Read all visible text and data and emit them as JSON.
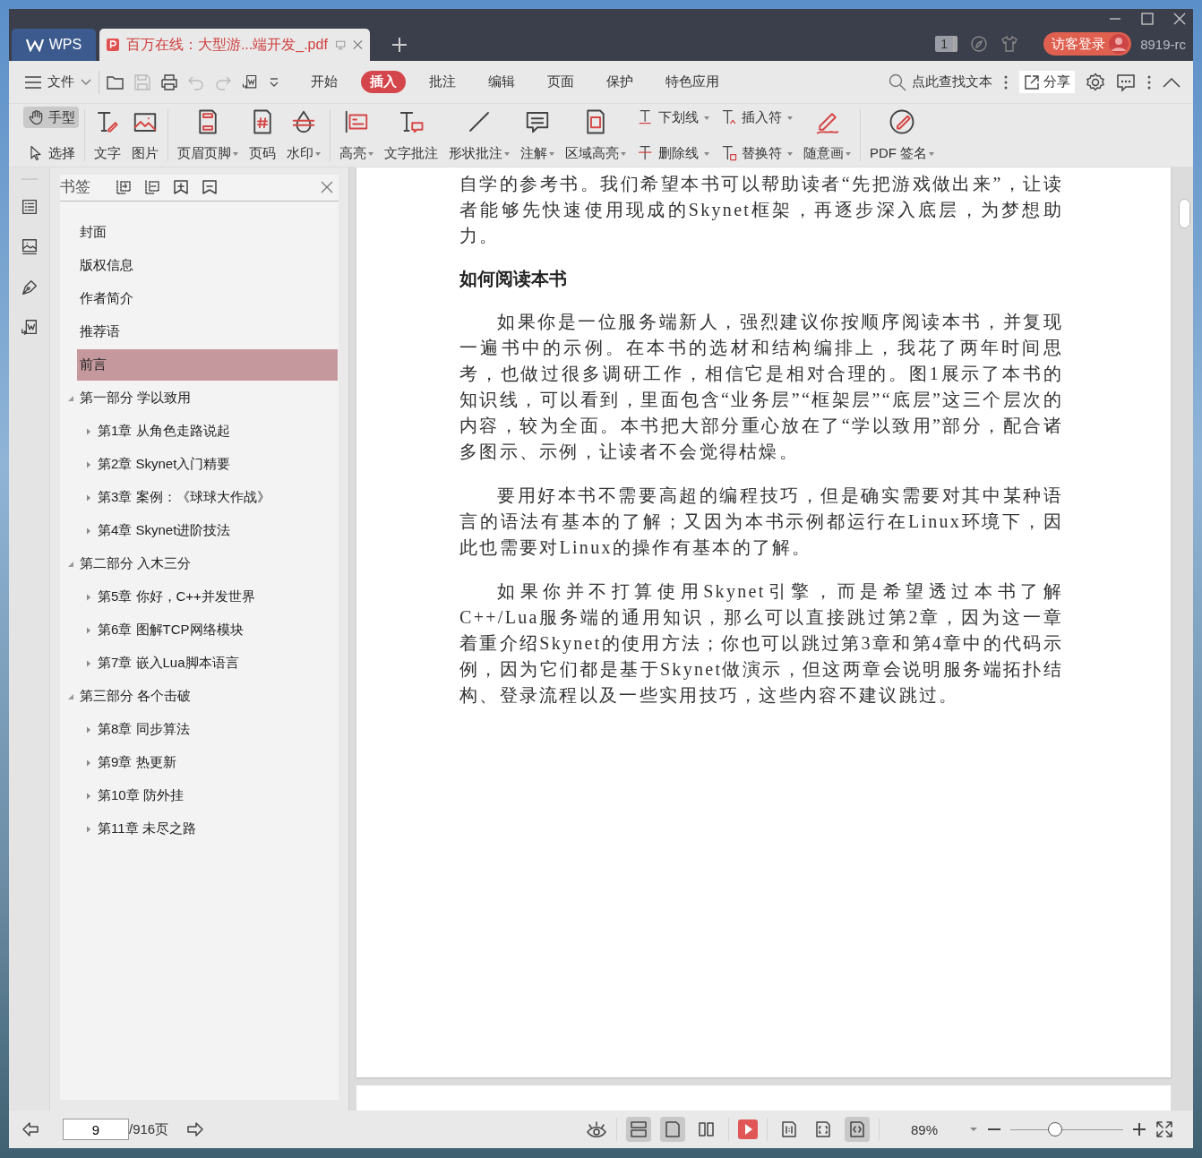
{
  "title_bar": {
    "app_tab": "WPS",
    "doc_tab": {
      "title": "百万在线：大型游...端开发_.pdf",
      "selected": true
    },
    "page_badge": "1",
    "login": "访客登录",
    "user": "8919-rc"
  },
  "menu_bar": {
    "file": "文件",
    "tabs": [
      {
        "label": "开始",
        "selected": false
      },
      {
        "label": "插入",
        "selected": true
      },
      {
        "label": "批注",
        "selected": false
      },
      {
        "label": "编辑",
        "selected": false
      },
      {
        "label": "页面",
        "selected": false
      },
      {
        "label": "保护",
        "selected": false
      },
      {
        "label": "特色应用",
        "selected": false
      }
    ],
    "search": "点此查找文本",
    "share": "分享"
  },
  "toolbar": {
    "groups": [
      {
        "columns": [
          {
            "items": [
              {
                "label": "手型",
                "kind": "small",
                "dropdown": false,
                "selected": true
              },
              {
                "label": "选择",
                "kind": "small",
                "dropdown": false,
                "selected": false
              }
            ]
          }
        ]
      },
      {
        "columns": [
          {
            "items": [
              {
                "label": "文字",
                "kind": "large",
                "dropdown": false
              }
            ]
          },
          {
            "items": [
              {
                "label": "图片",
                "kind": "large",
                "dropdown": false
              }
            ]
          }
        ]
      },
      {
        "columns": [
          {
            "items": [
              {
                "label": "页眉页脚",
                "kind": "large",
                "dropdown": true
              }
            ]
          },
          {
            "items": [
              {
                "label": "页码",
                "kind": "large",
                "dropdown": false
              }
            ]
          },
          {
            "items": [
              {
                "label": "水印",
                "kind": "large",
                "dropdown": true
              }
            ]
          }
        ]
      },
      {
        "columns": [
          {
            "items": [
              {
                "label": "高亮",
                "kind": "large",
                "dropdown": true
              }
            ]
          },
          {
            "items": [
              {
                "label": "文字批注",
                "kind": "large",
                "dropdown": false
              }
            ]
          },
          {
            "items": [
              {
                "label": "形状批注",
                "kind": "large",
                "dropdown": true
              }
            ]
          },
          {
            "items": [
              {
                "label": "注解",
                "kind": "large",
                "dropdown": true
              }
            ]
          },
          {
            "items": [
              {
                "label": "区域高亮",
                "kind": "large",
                "dropdown": true
              }
            ]
          },
          {
            "items": [
              {
                "label": "下划线",
                "kind": "small",
                "dropdown": true
              },
              {
                "label": "删除线",
                "kind": "small",
                "dropdown": true
              }
            ]
          },
          {
            "items": [
              {
                "label": "插入符",
                "kind": "small",
                "dropdown": true
              },
              {
                "label": "替换符",
                "kind": "small",
                "dropdown": true
              }
            ]
          },
          {
            "items": [
              {
                "label": "随意画",
                "kind": "large",
                "dropdown": true
              }
            ]
          }
        ]
      },
      {
        "columns": [
          {
            "items": [
              {
                "label": "PDF 签名",
                "kind": "large",
                "dropdown": true
              }
            ]
          }
        ]
      }
    ]
  },
  "bookmarks": {
    "title": "书签",
    "items": [
      {
        "label": "封面",
        "selected": false
      },
      {
        "label": "版权信息",
        "selected": false
      },
      {
        "label": "作者简介",
        "selected": false
      },
      {
        "label": "推荐语",
        "selected": false
      },
      {
        "label": "前言",
        "selected": true
      },
      {
        "label": "第一部分 学以致用",
        "selected": false,
        "expanded": true,
        "children": [
          {
            "label": "第1章 从角色走路说起",
            "selected": false,
            "expanded": false
          },
          {
            "label": "第2章 Skynet入门精要",
            "selected": false,
            "expanded": false
          },
          {
            "label": "第3章 案例：《球球大作战》",
            "selected": false,
            "expanded": false
          },
          {
            "label": "第4章 Skynet进阶技法",
            "selected": false,
            "expanded": false
          }
        ]
      },
      {
        "label": "第二部分 入木三分",
        "selected": false,
        "expanded": true,
        "children": [
          {
            "label": "第5章 你好，C++并发世界",
            "selected": false,
            "expanded": false
          },
          {
            "label": "第6章 图解TCP网络模块",
            "selected": false,
            "expanded": false
          },
          {
            "label": "第7章 嵌入Lua脚本语言",
            "selected": false,
            "expanded": false
          }
        ]
      },
      {
        "label": "第三部分 各个击破",
        "selected": false,
        "expanded": true,
        "children": [
          {
            "label": "第8章 同步算法",
            "selected": false,
            "expanded": false
          },
          {
            "label": "第9章 热更新",
            "selected": false,
            "expanded": false
          },
          {
            "label": "第10章 防外挂",
            "selected": false,
            "expanded": false
          },
          {
            "label": "第11章 未尽之路",
            "selected": false,
            "expanded": false
          }
        ]
      }
    ]
  },
  "page": {
    "blocks": [
      {
        "kind": "paragraph",
        "indent": false,
        "text": "自学的参考书。我们希望本书可以帮助读者“先把游戏做出来”，让读者能够先快速使用现成的Skynet框架，再逐步深入底层，为梦想助力。"
      },
      {
        "kind": "heading",
        "text": "如何阅读本书"
      },
      {
        "kind": "paragraph",
        "indent": true,
        "text": "如果你是一位服务端新人，强烈建议你按顺序阅读本书，并复现一遍书中的示例。在本书的选材和结构编排上，我花了两年时间思考，也做过很多调研工作，相信它是相对合理的。图1展示了本书的知识线，可以看到，里面包含“业务层”“框架层”“底层”这三个层次的内容，较为全面。本书把大部分重心放在了“学以致用”部分，配合诸多图示、示例，让读者不会觉得枯燥。"
      },
      {
        "kind": "paragraph",
        "indent": true,
        "text": "要用好本书不需要高超的编程技巧，但是确实需要对其中某种语言的语法有基本的了解；又因为本书示例都运行在Linux环境下，因此也需要对Linux的操作有基本的了解。"
      },
      {
        "kind": "paragraph",
        "indent": true,
        "text": "如果你并不打算使用Skynet引擎，而是希望透过本书了解C++/Lua服务端的通用知识，那么可以直接跳过第2章，因为这一章着重介绍Skynet的使用方法；你也可以跳过第3章和第4章中的代码示例，因为它们都是基于Skynet做演示，但这两章会说明服务端拓扑结构、登录流程以及一些实用技巧，这些内容不建议跳过。"
      }
    ]
  },
  "status_bar": {
    "page": "9",
    "total": "/916页",
    "view_modes": [
      {
        "selected": true
      },
      {
        "selected": true
      },
      {
        "selected": false
      }
    ],
    "fit_modes": [
      {
        "selected": false
      },
      {
        "selected": false
      },
      {
        "selected": true
      }
    ],
    "zoom": "89%",
    "zoom_slider": {
      "level": 0.4
    }
  }
}
